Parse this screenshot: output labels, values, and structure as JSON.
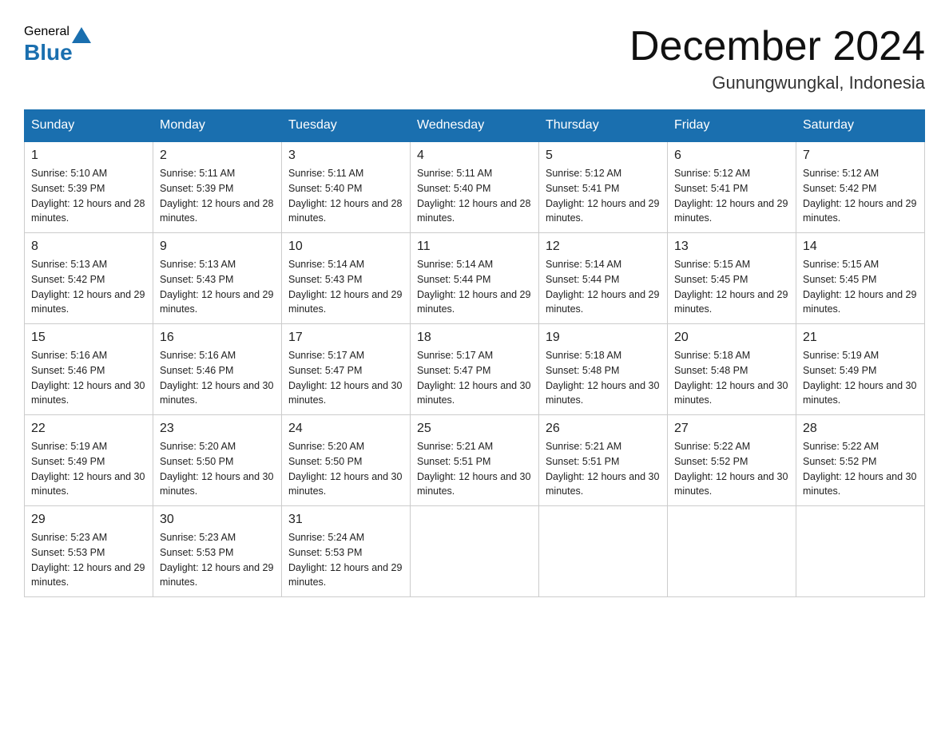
{
  "header": {
    "logo_general": "General",
    "logo_blue": "Blue",
    "month_title": "December 2024",
    "location": "Gunungwungkal, Indonesia"
  },
  "days_of_week": [
    "Sunday",
    "Monday",
    "Tuesday",
    "Wednesday",
    "Thursday",
    "Friday",
    "Saturday"
  ],
  "weeks": [
    [
      {
        "day": "1",
        "sunrise": "5:10 AM",
        "sunset": "5:39 PM",
        "daylight": "12 hours and 28 minutes."
      },
      {
        "day": "2",
        "sunrise": "5:11 AM",
        "sunset": "5:39 PM",
        "daylight": "12 hours and 28 minutes."
      },
      {
        "day": "3",
        "sunrise": "5:11 AM",
        "sunset": "5:40 PM",
        "daylight": "12 hours and 28 minutes."
      },
      {
        "day": "4",
        "sunrise": "5:11 AM",
        "sunset": "5:40 PM",
        "daylight": "12 hours and 28 minutes."
      },
      {
        "day": "5",
        "sunrise": "5:12 AM",
        "sunset": "5:41 PM",
        "daylight": "12 hours and 29 minutes."
      },
      {
        "day": "6",
        "sunrise": "5:12 AM",
        "sunset": "5:41 PM",
        "daylight": "12 hours and 29 minutes."
      },
      {
        "day": "7",
        "sunrise": "5:12 AM",
        "sunset": "5:42 PM",
        "daylight": "12 hours and 29 minutes."
      }
    ],
    [
      {
        "day": "8",
        "sunrise": "5:13 AM",
        "sunset": "5:42 PM",
        "daylight": "12 hours and 29 minutes."
      },
      {
        "day": "9",
        "sunrise": "5:13 AM",
        "sunset": "5:43 PM",
        "daylight": "12 hours and 29 minutes."
      },
      {
        "day": "10",
        "sunrise": "5:14 AM",
        "sunset": "5:43 PM",
        "daylight": "12 hours and 29 minutes."
      },
      {
        "day": "11",
        "sunrise": "5:14 AM",
        "sunset": "5:44 PM",
        "daylight": "12 hours and 29 minutes."
      },
      {
        "day": "12",
        "sunrise": "5:14 AM",
        "sunset": "5:44 PM",
        "daylight": "12 hours and 29 minutes."
      },
      {
        "day": "13",
        "sunrise": "5:15 AM",
        "sunset": "5:45 PM",
        "daylight": "12 hours and 29 minutes."
      },
      {
        "day": "14",
        "sunrise": "5:15 AM",
        "sunset": "5:45 PM",
        "daylight": "12 hours and 29 minutes."
      }
    ],
    [
      {
        "day": "15",
        "sunrise": "5:16 AM",
        "sunset": "5:46 PM",
        "daylight": "12 hours and 30 minutes."
      },
      {
        "day": "16",
        "sunrise": "5:16 AM",
        "sunset": "5:46 PM",
        "daylight": "12 hours and 30 minutes."
      },
      {
        "day": "17",
        "sunrise": "5:17 AM",
        "sunset": "5:47 PM",
        "daylight": "12 hours and 30 minutes."
      },
      {
        "day": "18",
        "sunrise": "5:17 AM",
        "sunset": "5:47 PM",
        "daylight": "12 hours and 30 minutes."
      },
      {
        "day": "19",
        "sunrise": "5:18 AM",
        "sunset": "5:48 PM",
        "daylight": "12 hours and 30 minutes."
      },
      {
        "day": "20",
        "sunrise": "5:18 AM",
        "sunset": "5:48 PM",
        "daylight": "12 hours and 30 minutes."
      },
      {
        "day": "21",
        "sunrise": "5:19 AM",
        "sunset": "5:49 PM",
        "daylight": "12 hours and 30 minutes."
      }
    ],
    [
      {
        "day": "22",
        "sunrise": "5:19 AM",
        "sunset": "5:49 PM",
        "daylight": "12 hours and 30 minutes."
      },
      {
        "day": "23",
        "sunrise": "5:20 AM",
        "sunset": "5:50 PM",
        "daylight": "12 hours and 30 minutes."
      },
      {
        "day": "24",
        "sunrise": "5:20 AM",
        "sunset": "5:50 PM",
        "daylight": "12 hours and 30 minutes."
      },
      {
        "day": "25",
        "sunrise": "5:21 AM",
        "sunset": "5:51 PM",
        "daylight": "12 hours and 30 minutes."
      },
      {
        "day": "26",
        "sunrise": "5:21 AM",
        "sunset": "5:51 PM",
        "daylight": "12 hours and 30 minutes."
      },
      {
        "day": "27",
        "sunrise": "5:22 AM",
        "sunset": "5:52 PM",
        "daylight": "12 hours and 30 minutes."
      },
      {
        "day": "28",
        "sunrise": "5:22 AM",
        "sunset": "5:52 PM",
        "daylight": "12 hours and 30 minutes."
      }
    ],
    [
      {
        "day": "29",
        "sunrise": "5:23 AM",
        "sunset": "5:53 PM",
        "daylight": "12 hours and 29 minutes."
      },
      {
        "day": "30",
        "sunrise": "5:23 AM",
        "sunset": "5:53 PM",
        "daylight": "12 hours and 29 minutes."
      },
      {
        "day": "31",
        "sunrise": "5:24 AM",
        "sunset": "5:53 PM",
        "daylight": "12 hours and 29 minutes."
      },
      null,
      null,
      null,
      null
    ]
  ],
  "labels": {
    "sunrise_prefix": "Sunrise: ",
    "sunset_prefix": "Sunset: ",
    "daylight_prefix": "Daylight: "
  }
}
